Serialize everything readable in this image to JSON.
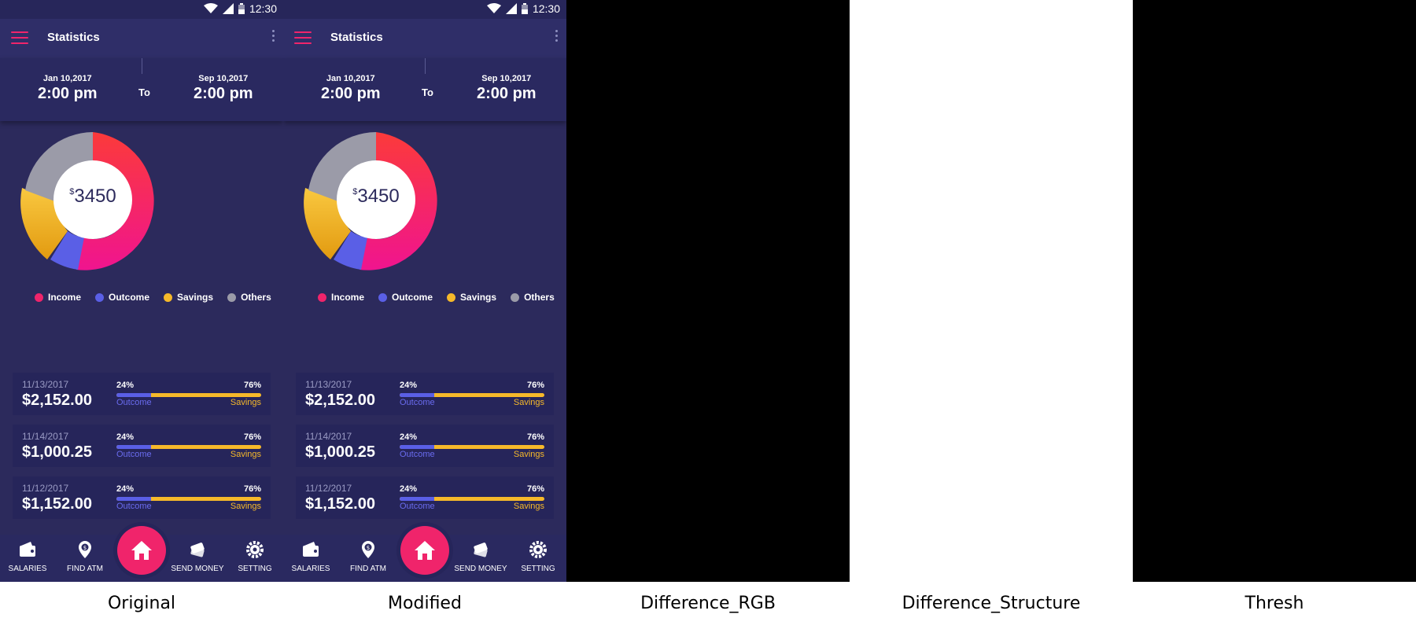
{
  "status": {
    "time": "12:30"
  },
  "app": {
    "title": "Statistics"
  },
  "range": {
    "from": {
      "date": "Jan 10,2017",
      "time": "2:00 pm"
    },
    "to_label": "To",
    "to": {
      "date": "Sep 10,2017",
      "time": "2:00 pm"
    }
  },
  "donut": {
    "currency": "$",
    "total": "3450",
    "segments": [
      {
        "name": "Income",
        "percent": 45,
        "color": "#f0246b"
      },
      {
        "name": "Outcome",
        "percent": 7,
        "color": "#5a5fe6"
      },
      {
        "name": "Savings",
        "percent": 23,
        "color": "#f6b92a"
      },
      {
        "name": "Others",
        "percent": 25,
        "color": "#9b9ba8"
      }
    ]
  },
  "legend": [
    {
      "label": "Income",
      "color": "#f0246b"
    },
    {
      "label": "Outcome",
      "color": "#5a5fe6"
    },
    {
      "label": "Savings",
      "color": "#f6b92a"
    },
    {
      "label": "Others",
      "color": "#9b9ba8"
    }
  ],
  "transactions": [
    {
      "date": "11/13/2017",
      "amount": "$2,152.00",
      "left_pct": "24%",
      "right_pct": "76%",
      "outcome_fraction": 0.24,
      "left_label": "Outcome",
      "right_label": "Savings"
    },
    {
      "date": "11/14/2017",
      "amount": "$1,000.25",
      "left_pct": "24%",
      "right_pct": "76%",
      "outcome_fraction": 0.24,
      "left_label": "Outcome",
      "right_label": "Savings"
    },
    {
      "date": "11/12/2017",
      "amount": "$1,152.00",
      "left_pct": "24%",
      "right_pct": "76%",
      "outcome_fraction": 0.24,
      "left_label": "Outcome",
      "right_label": "Savings"
    }
  ],
  "nav": {
    "salaries": "SALARIES",
    "find_atm": "FIND ATM",
    "send_money": "SEND MONEY",
    "setting": "SETTING"
  },
  "captions": [
    "Original",
    "Modified",
    "Difference_RGB",
    "Difference_Structure",
    "Thresh"
  ]
}
